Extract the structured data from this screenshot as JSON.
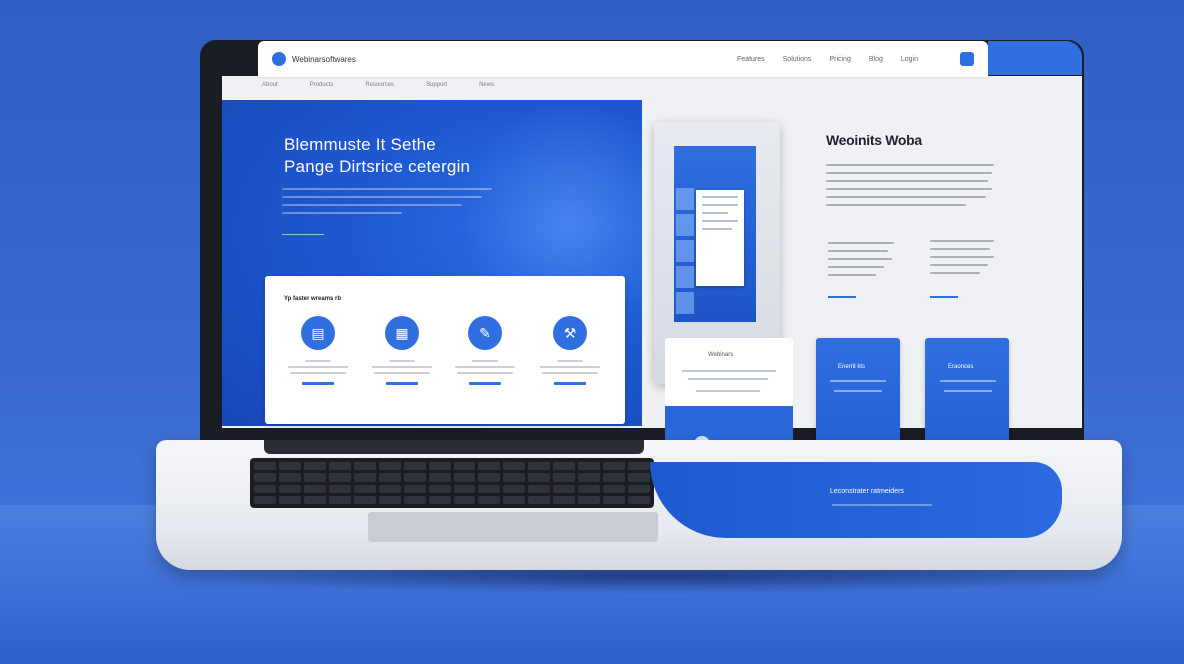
{
  "header": {
    "logo_text": "Webinarsoftwares",
    "nav_links": [
      "Features",
      "Solutions",
      "Pricing",
      "Blog",
      "Login"
    ]
  },
  "subnav": [
    "About",
    "Products",
    "Resources",
    "Support",
    "News"
  ],
  "hero": {
    "title_line1": "Blemmuste It Sethe",
    "title_line2": "Pange Dirtsrice cetergin"
  },
  "features": {
    "title": "Yp faster wreams rb",
    "icons": [
      "book-icon",
      "document-icon",
      "pen-icon",
      "tools-icon"
    ]
  },
  "info": {
    "title": "Weoinits Woba"
  },
  "cards": {
    "light_title": "Webinars",
    "blue1_title": "Enerrit kts",
    "blue2_title": "Eraonces"
  },
  "cta": {
    "text": "Leconstrater ratmeiders"
  },
  "colors": {
    "brand_blue": "#2f6fe0",
    "background": "#3a6ad0"
  }
}
